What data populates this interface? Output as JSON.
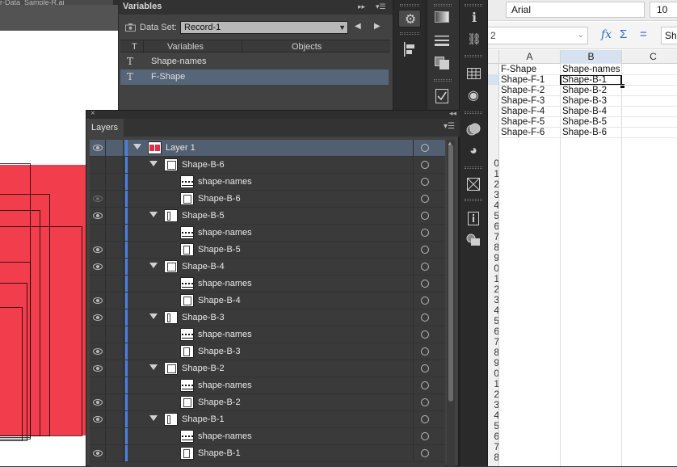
{
  "canvas": {
    "doc_tab": "r-Data_Sample-R.ai"
  },
  "variables_panel": {
    "title": "Variables",
    "btn_expand": "▸▸",
    "btn_menu": "▾☰",
    "dataset_label": "Data Set:",
    "dataset_value": "Record-1",
    "dataset_arrow": "▼",
    "prev": "◀",
    "next": "▶",
    "col_type": "T",
    "col_variables": "Variables",
    "col_objects": "Objects",
    "rows": [
      {
        "type": "T",
        "name": "Shape-names"
      },
      {
        "type": "T",
        "name": "F-Shape"
      }
    ]
  },
  "excel": {
    "font": "Arial",
    "font_size": "10",
    "namebox": "2",
    "namebox_arrow": "⌄",
    "fx": "fx",
    "sum": "Σ",
    "eq": "=",
    "formula": "Sh",
    "columns": [
      "A",
      "B",
      "C"
    ],
    "cells": [
      [
        "F-Shape",
        "Shape-names"
      ],
      [
        "Shape-F-1",
        "Shape-B-1"
      ],
      [
        "Shape-F-2",
        "Shape-B-2"
      ],
      [
        "Shape-F-3",
        "Shape-B-3"
      ],
      [
        "Shape-F-4",
        "Shape-B-4"
      ],
      [
        "Shape-F-5",
        "Shape-B-5"
      ],
      [
        "Shape-F-6",
        "Shape-B-6"
      ]
    ],
    "row_digits": [
      "",
      "",
      "",
      "",
      "",
      "",
      "",
      "",
      "",
      "0",
      "1",
      "2",
      "3",
      "4",
      "5",
      "6",
      "7",
      "8",
      "9",
      "0",
      "1",
      "2",
      "3",
      "4",
      "5",
      "6",
      "7",
      "8",
      "9",
      "0",
      "1",
      "2",
      "3",
      "4",
      "5",
      "6",
      "7",
      "8"
    ]
  },
  "layers_panel": {
    "close": "×",
    "collapse": "◂◂",
    "tab": "Layers",
    "menu": "▾☰",
    "scroll_up": "▲",
    "rows": [
      {
        "name": "Layer 1",
        "kind": "layer",
        "eye": true
      },
      {
        "name": "Shape-B-6",
        "kind": "group",
        "eye": false
      },
      {
        "name": "shape-names",
        "kind": "text",
        "eye": false
      },
      {
        "name": "Shape-B-6",
        "kind": "path",
        "eye": false
      },
      {
        "name": "Shape-B-5",
        "kind": "group",
        "eye": true
      },
      {
        "name": "shape-names",
        "kind": "text",
        "eye": false
      },
      {
        "name": "Shape-B-5",
        "kind": "path",
        "eye": true
      },
      {
        "name": "Shape-B-4",
        "kind": "group",
        "eye": true
      },
      {
        "name": "shape-names",
        "kind": "text",
        "eye": false
      },
      {
        "name": "Shape-B-4",
        "kind": "path",
        "eye": true
      },
      {
        "name": "Shape-B-3",
        "kind": "group",
        "eye": true
      },
      {
        "name": "shape-names",
        "kind": "text",
        "eye": false
      },
      {
        "name": "Shape-B-3",
        "kind": "path",
        "eye": true
      },
      {
        "name": "Shape-B-2",
        "kind": "group",
        "eye": true
      },
      {
        "name": "shape-names",
        "kind": "text",
        "eye": false
      },
      {
        "name": "Shape-B-2",
        "kind": "path",
        "eye": true
      },
      {
        "name": "Shape-B-1",
        "kind": "group",
        "eye": true
      },
      {
        "name": "shape-names",
        "kind": "text",
        "eye": false
      },
      {
        "name": "Shape-B-1",
        "kind": "path",
        "eye": true
      }
    ]
  },
  "icons": {
    "gear": "⚙",
    "info": "ℹ",
    "link": "⛓",
    "circle": "◉",
    "palette": "◕"
  }
}
